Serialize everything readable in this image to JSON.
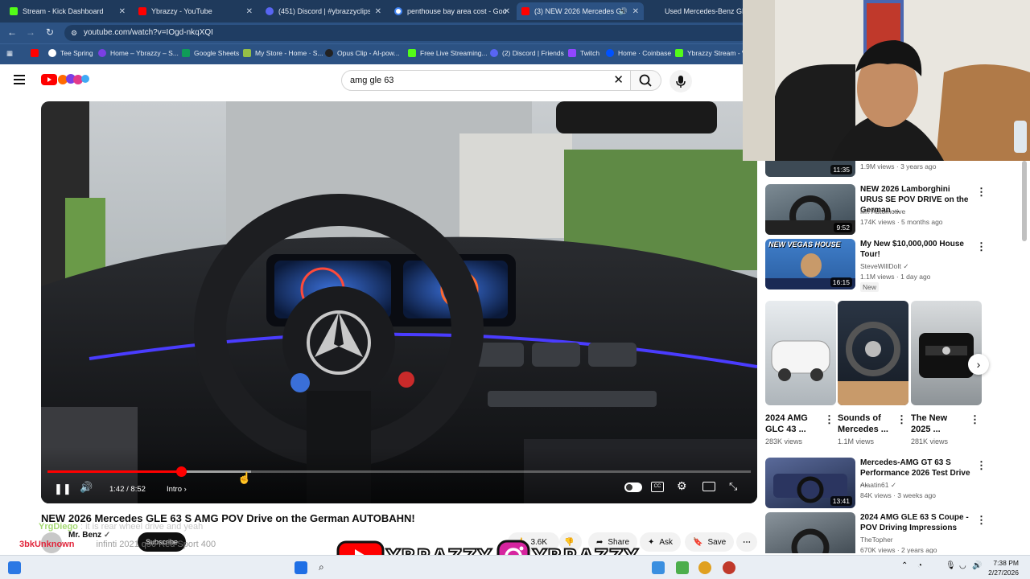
{
  "tabs": [
    {
      "label": "Stream - Kick Dashboard",
      "color": "#53fc18"
    },
    {
      "label": "Ybrazzy - YouTube",
      "color": "#ff0000"
    },
    {
      "label": "(451) Discord | #ybrazzyclips | Y",
      "color": "#5865f2"
    },
    {
      "label": "penthouse bay area cost - Goo",
      "color": "#4285f4"
    },
    {
      "label": "(3) NEW 2026 Mercedes GL",
      "color": "#ff0000"
    },
    {
      "label": "Used Mercedes-Benz GLA fo",
      "color": "#8ab4f8"
    }
  ],
  "url": "youtube.com/watch?v=IOgd-nkqXQI",
  "bookmarks": [
    {
      "label": "",
      "color": "#ff0000"
    },
    {
      "label": "Tee Spring",
      "color": "#ffffff"
    },
    {
      "label": "Home – Ybrazzy – S...",
      "color": "#7b3fe4"
    },
    {
      "label": "Google Sheets",
      "color": "#0f9d58"
    },
    {
      "label": "My Store - Home · S...",
      "color": "#95bf47"
    },
    {
      "label": "Opus Clip - AI-pow...",
      "color": "#222222"
    },
    {
      "label": "Free Live Streaming...",
      "color": "#53fc18"
    },
    {
      "label": "(2) Discord | Friends",
      "color": "#5865f2"
    },
    {
      "label": "Twitch",
      "color": "#9146ff"
    },
    {
      "label": "Home · Coinbase",
      "color": "#0052ff"
    },
    {
      "label": "Ybrazzy Stream - W",
      "color": "#53fc18"
    }
  ],
  "search": {
    "query": "amg gle 63"
  },
  "player": {
    "time": "1:42 / 8:52",
    "chapter": "Intro",
    "progress": 0.19,
    "buffered": 0.29
  },
  "video": {
    "title": "NEW 2026 Mercedes GLE 63 S AMG POV Drive on the German AUTOBAHN!",
    "channel": "Mr. Benz",
    "subscribe": "Subscribe",
    "likes": "3.6K",
    "share": "Share",
    "ask": "Ask",
    "save": "Save"
  },
  "recommendations": [
    {
      "title": "",
      "channel": "",
      "meta": "1.9M views · 3 years ago",
      "duration": "11:35",
      "color": "#3d4a55",
      "new": ""
    },
    {
      "title": "NEW 2026 Lamborghini URUS SE POV DRIVE on the German ...",
      "channel": "Mr. Automotive",
      "meta": "174K views · 5 months ago",
      "duration": "9:52",
      "color": "#556a78",
      "new": ""
    },
    {
      "title": "My New $10,000,000 House Tour!",
      "channel": "SteveWillDoIt",
      "meta": "1.1M views · 1 day ago",
      "duration": "16:15",
      "color": "#3f7ec9",
      "new": "New",
      "thumb_text": "NEW VEGAS HOUSE"
    },
    {
      "title": "Mercedes-AMG GT 63 S Performance 2026 Test Drive ...",
      "channel": "Alaatin61",
      "meta": "84K views · 3 weeks ago",
      "duration": "13:41",
      "color": "#2d3a5c",
      "new": ""
    },
    {
      "title": "2024 AMG GLE 63 S Coupe - POV Driving Impressions",
      "channel": "TheTopher",
      "meta": "670K views · 2 years ago",
      "duration": "",
      "color": "#4b5863",
      "new": ""
    }
  ],
  "shorts": [
    {
      "title": "2024 AMG GLC 43 ...",
      "views": "283K views",
      "color": "#d8dde2"
    },
    {
      "title": "Sounds of Mercedes ...",
      "views": "1.1M views",
      "color": "#2a3544"
    },
    {
      "title": "The New 2025 ...",
      "views": "281K views",
      "color": "#bfc4c8"
    }
  ],
  "overlay": {
    "chat_user": "YrgDiego",
    "chat_text": "it is rear wheel drive and yeah",
    "chat_user2": "3bkUnknown",
    "chat_text2": "infinti 2021 q50 Red Sport 400",
    "brand_left": "YBRAZZY",
    "brand_right": "YBRAZZY"
  },
  "clock": {
    "time": "7:38 PM",
    "date": "2/27/2026"
  }
}
